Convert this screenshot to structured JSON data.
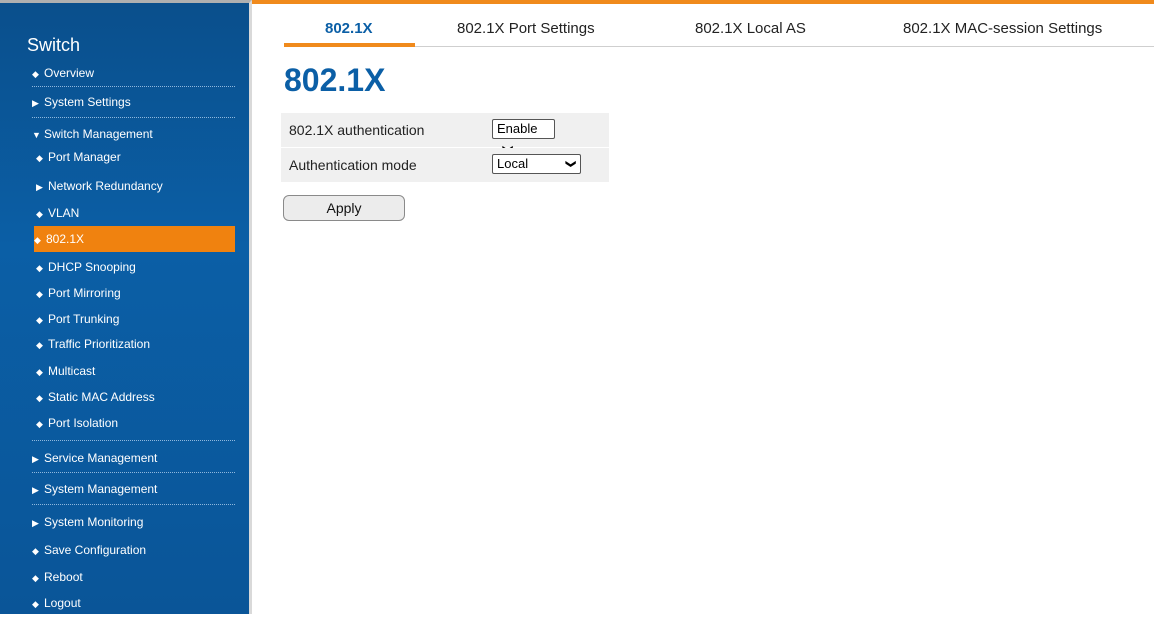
{
  "sidebar": {
    "title": "Switch",
    "items": [
      {
        "label": "Overview",
        "icon": "bullet"
      },
      {
        "label": "System Settings",
        "icon": "triangle-right"
      },
      {
        "label": "Switch Management",
        "icon": "triangle-down"
      },
      {
        "label": "Port Manager",
        "icon": "bullet"
      },
      {
        "label": "Network Redundancy",
        "icon": "triangle-right"
      },
      {
        "label": "VLAN",
        "icon": "bullet"
      },
      {
        "label": "802.1X",
        "icon": "bullet"
      },
      {
        "label": "DHCP Snooping",
        "icon": "bullet"
      },
      {
        "label": "Port Mirroring",
        "icon": "bullet"
      },
      {
        "label": "Port Trunking",
        "icon": "bullet"
      },
      {
        "label": "Traffic Prioritization",
        "icon": "bullet"
      },
      {
        "label": "Multicast",
        "icon": "bullet"
      },
      {
        "label": "Static MAC Address",
        "icon": "bullet"
      },
      {
        "label": "Port Isolation",
        "icon": "bullet"
      },
      {
        "label": "Service Management",
        "icon": "triangle-right"
      },
      {
        "label": "System Management",
        "icon": "triangle-right"
      },
      {
        "label": "System Monitoring",
        "icon": "triangle-right"
      },
      {
        "label": "Save Configuration",
        "icon": "bullet"
      },
      {
        "label": "Reboot",
        "icon": "bullet"
      },
      {
        "label": "Logout",
        "icon": "bullet"
      }
    ],
    "active_item": "802.1X"
  },
  "tabs": [
    {
      "label": "802.1X",
      "active": true
    },
    {
      "label": "802.1X Port Settings",
      "active": false
    },
    {
      "label": "802.1X Local AS",
      "active": false
    },
    {
      "label": "802.1X MAC-session Settings",
      "active": false
    }
  ],
  "page": {
    "title": "802.1X"
  },
  "form": {
    "auth_label": "802.1X authentication",
    "auth_value": "Enable",
    "mode_label": "Authentication mode",
    "mode_value": "Local",
    "apply_label": "Apply"
  },
  "colors": {
    "accent": "#f08a1c",
    "brand_blue": "#0b5fa6",
    "sidebar_bg": "#0a5598"
  }
}
